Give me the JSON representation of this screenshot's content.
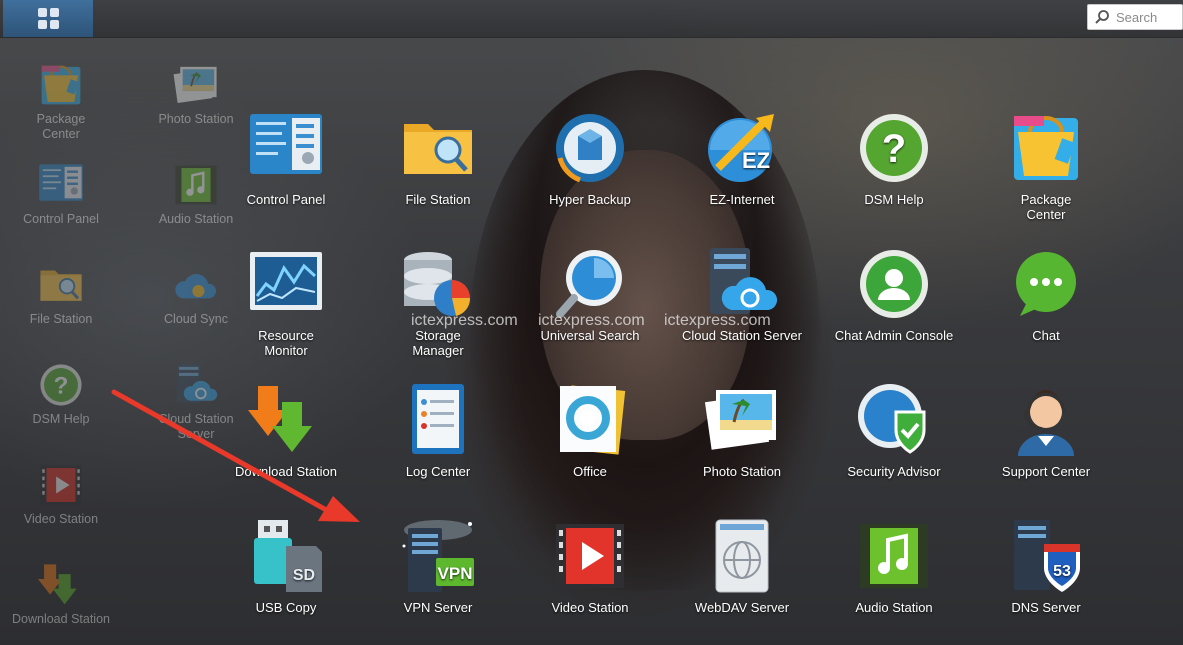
{
  "topbar": {
    "main_menu_icon": "grid-icon",
    "search": {
      "placeholder": "Search",
      "icon": "search-icon"
    }
  },
  "desktop": {
    "items": [
      {
        "label_lines": [
          "Package",
          "Center"
        ],
        "icon": "package-center-icon"
      },
      {
        "label_lines": [
          "Photo Station"
        ],
        "icon": "photo-station-icon"
      },
      {
        "label_lines": [
          "Control Panel"
        ],
        "icon": "control-panel-icon"
      },
      {
        "label_lines": [
          "Audio Station"
        ],
        "icon": "audio-station-icon"
      },
      {
        "label_lines": [
          "File Station"
        ],
        "icon": "file-station-icon"
      },
      {
        "label_lines": [
          "Cloud Sync"
        ],
        "icon": "cloud-sync-icon"
      },
      {
        "label_lines": [
          "DSM Help"
        ],
        "icon": "dsm-help-icon"
      },
      {
        "label_lines": [
          "Cloud Station Server"
        ],
        "icon": "cloud-station-server-icon"
      },
      {
        "label_lines": [
          "Video Station"
        ],
        "icon": "video-station-icon"
      },
      {
        "label_lines": [
          "Download Station"
        ],
        "icon": "download-station-icon"
      }
    ]
  },
  "launcher": {
    "rows": [
      [
        {
          "label_lines": [
            "Control Panel"
          ],
          "icon": "control-panel-icon"
        },
        {
          "label_lines": [
            "File Station"
          ],
          "icon": "file-station-icon"
        },
        {
          "label_lines": [
            "Hyper Backup"
          ],
          "icon": "hyper-backup-icon"
        },
        {
          "label_lines": [
            "EZ-Internet"
          ],
          "icon": "ez-internet-icon"
        },
        {
          "label_lines": [
            "DSM Help"
          ],
          "icon": "dsm-help-icon"
        },
        {
          "label_lines": [
            "Package",
            "Center"
          ],
          "icon": "package-center-icon"
        }
      ],
      [
        {
          "label_lines": [
            "Resource",
            "Monitor"
          ],
          "icon": "resource-monitor-icon"
        },
        {
          "label_lines": [
            "Storage",
            "Manager"
          ],
          "icon": "storage-manager-icon"
        },
        {
          "label_lines": [
            "Universal Search"
          ],
          "icon": "universal-search-icon"
        },
        {
          "label_lines": [
            "Cloud Station Server"
          ],
          "icon": "cloud-station-server-icon"
        },
        {
          "label_lines": [
            "Chat Admin Console"
          ],
          "icon": "chat-admin-console-icon"
        },
        {
          "label_lines": [
            "Chat"
          ],
          "icon": "chat-icon"
        }
      ],
      [
        {
          "label_lines": [
            "Download Station"
          ],
          "icon": "download-station-icon"
        },
        {
          "label_lines": [
            "Log Center"
          ],
          "icon": "log-center-icon"
        },
        {
          "label_lines": [
            "Office"
          ],
          "icon": "office-icon"
        },
        {
          "label_lines": [
            "Photo Station"
          ],
          "icon": "photo-station-icon"
        },
        {
          "label_lines": [
            "Security Advisor"
          ],
          "icon": "security-advisor-icon"
        },
        {
          "label_lines": [
            "Support Center"
          ],
          "icon": "support-center-icon"
        }
      ],
      [
        {
          "label_lines": [
            "USB Copy"
          ],
          "icon": "usb-copy-icon"
        },
        {
          "label_lines": [
            "VPN Server"
          ],
          "icon": "vpn-server-icon"
        },
        {
          "label_lines": [
            "Video Station"
          ],
          "icon": "video-station-icon"
        },
        {
          "label_lines": [
            "WebDAV Server"
          ],
          "icon": "webdav-server-icon"
        },
        {
          "label_lines": [
            "Audio Station"
          ],
          "icon": "audio-station-icon"
        },
        {
          "label_lines": [
            "DNS Server"
          ],
          "icon": "dns-server-icon"
        }
      ]
    ]
  },
  "icon_text": {
    "ez": "EZ",
    "vpn": "VPN",
    "sd": "SD",
    "dns_number": "53",
    "help_mark": "?"
  },
  "watermark": [
    "ictexpress.com",
    "ictexpress.com",
    "ictexpress.com"
  ],
  "annotation": {
    "arrow_color": "#e8392a",
    "points_to": "VPN Server"
  }
}
